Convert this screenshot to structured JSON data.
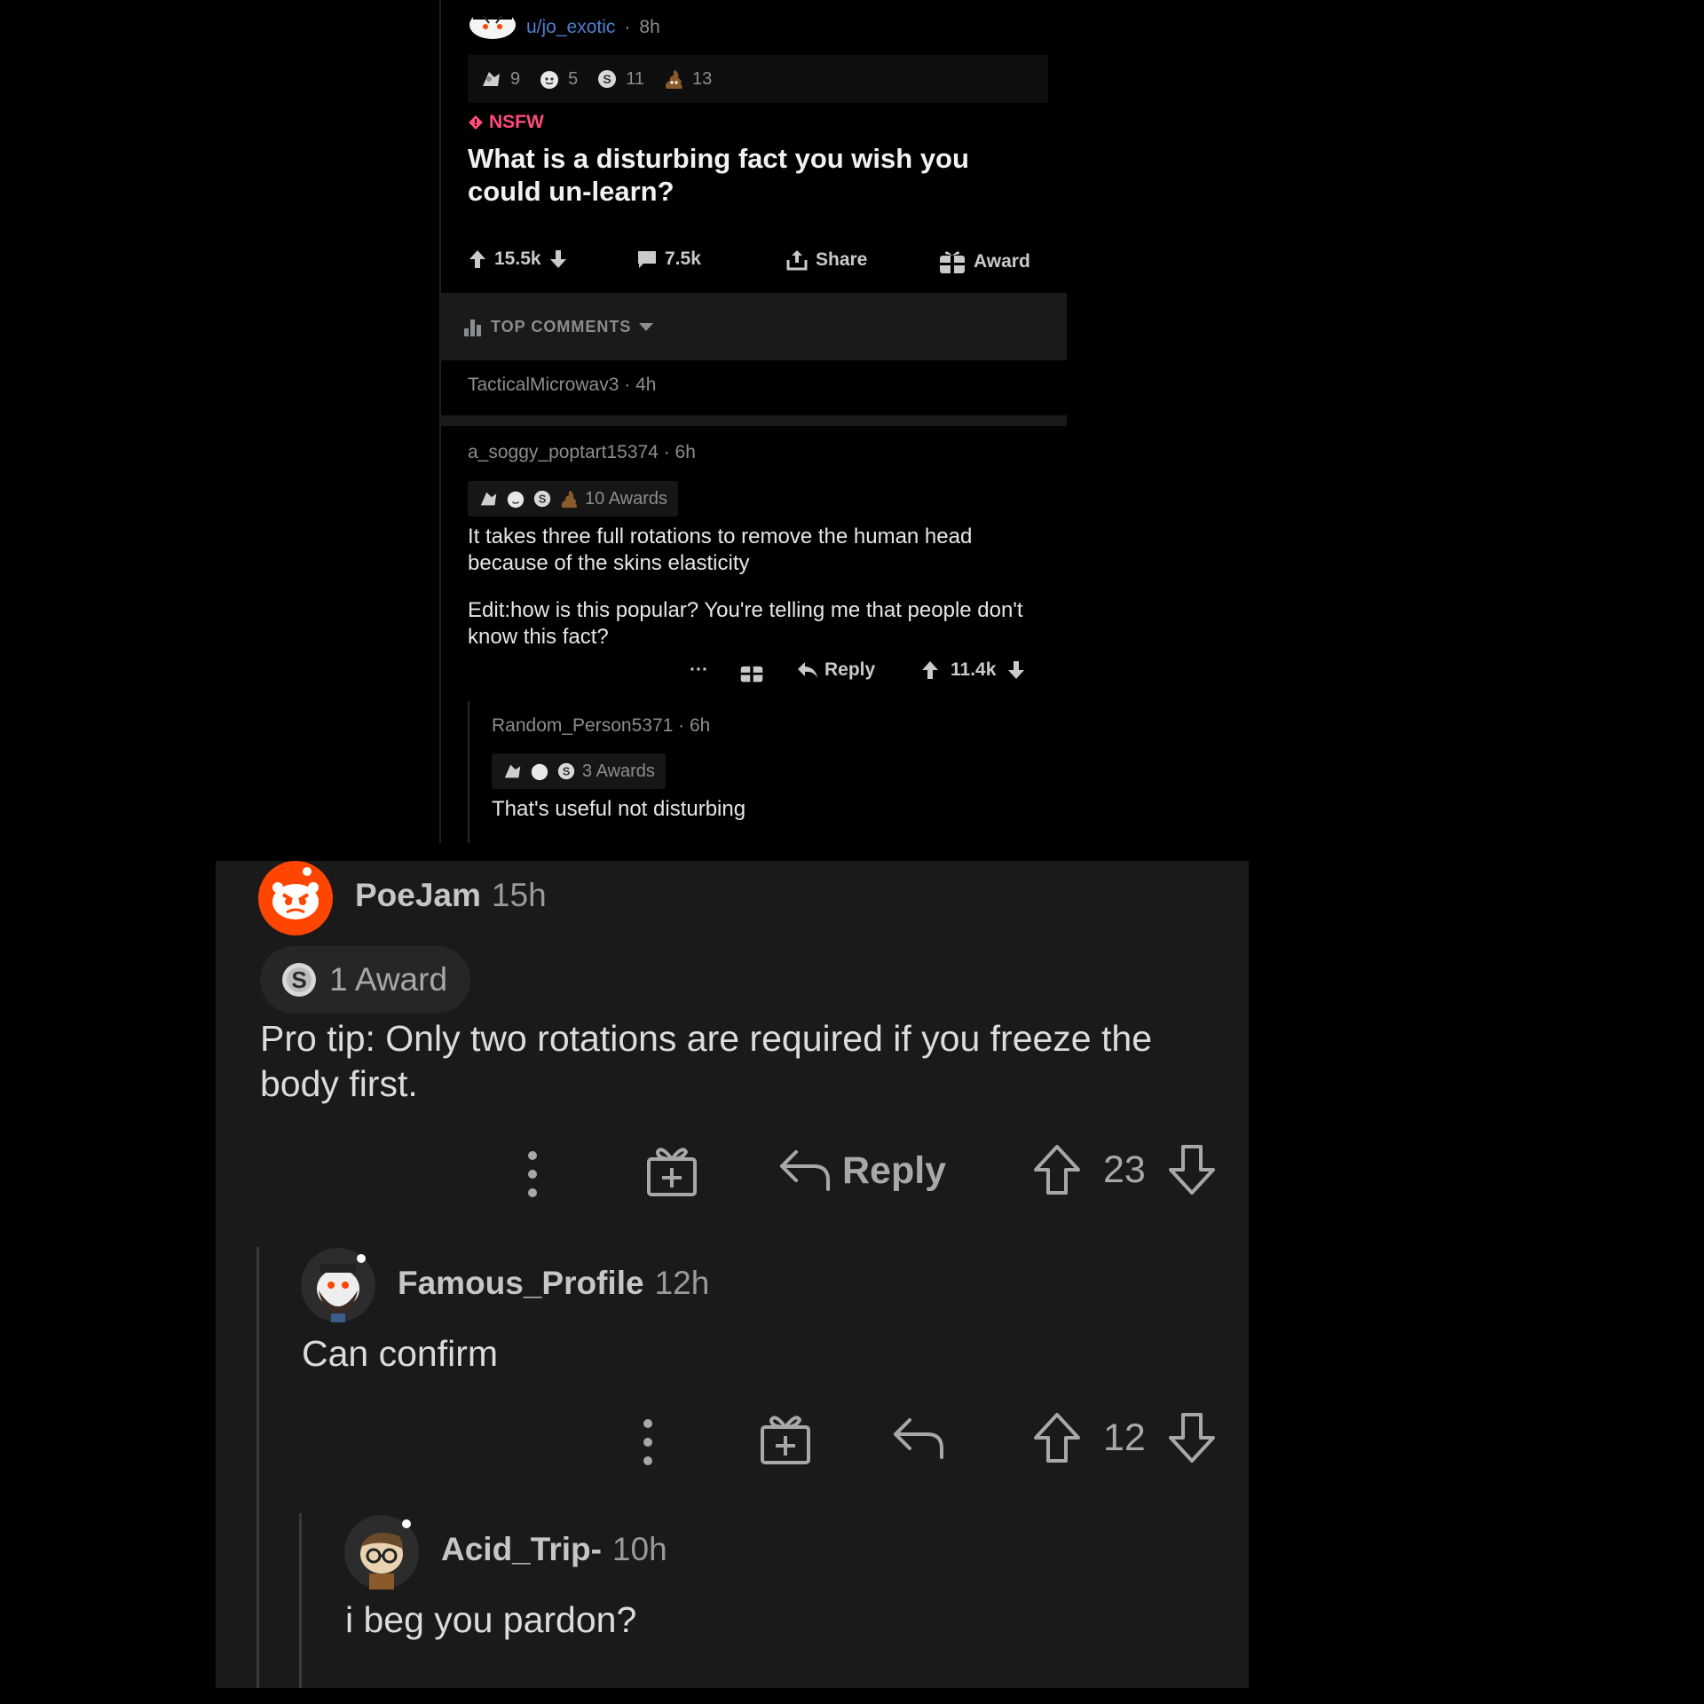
{
  "post": {
    "username": "u/jo_exotic",
    "time": "8h",
    "awards": [
      {
        "icon": "silver-award-icon",
        "count": "9"
      },
      {
        "icon": "wholesome-award-icon",
        "count": "5"
      },
      {
        "icon": "silver-coin-award-icon",
        "count": "11"
      },
      {
        "icon": "poop-award-icon",
        "count": "13"
      }
    ],
    "nsfw_label": "NSFW",
    "title": "What is a disturbing fact you wish you could un-learn?",
    "upvotes": "15.5k",
    "comments": "7.5k",
    "share_label": "Share",
    "award_label": "Award"
  },
  "sort": {
    "label": "TOP COMMENTS"
  },
  "collapsed_comment": {
    "username": "TacticalMicrowav3",
    "time": "4h"
  },
  "comment1": {
    "username": "a_soggy_poptart15374",
    "time": "6h",
    "awards_label": "10 Awards",
    "body_p1": "It takes three full rotations to remove the human head because of the skins elasticity",
    "body_p2": "Edit:how is this popular? You're telling me that people don't know this fact?",
    "more": "···",
    "reply_label": "Reply",
    "score": "11.4k"
  },
  "comment2": {
    "username": "Random_Person5371",
    "time": "6h",
    "awards_label": "3 Awards",
    "body": "That's useful not disturbing"
  },
  "poejam": {
    "username": "PoeJam",
    "time": "15h",
    "awards_label": "1 Award",
    "body": "Pro tip: Only two rotations are required if you freeze the body first.",
    "reply_label": "Reply",
    "score": "23",
    "accent": "#ff4500"
  },
  "famous": {
    "username": "Famous_Profile",
    "time": "12h",
    "body": "Can confirm",
    "score": "12"
  },
  "acid": {
    "username": "Acid_Trip-",
    "time": "10h",
    "body": "i beg you pardon?"
  }
}
